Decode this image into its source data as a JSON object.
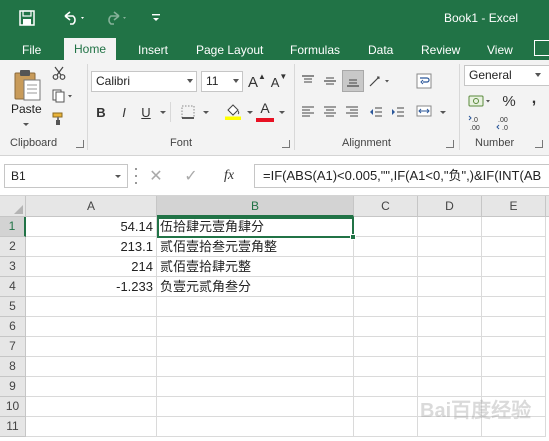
{
  "window": {
    "title": "Book1 - Excel",
    "accent": "#217346"
  },
  "qat": {
    "save_icon": "save-icon",
    "undo_icon": "undo-icon",
    "redo_icon": "redo-icon"
  },
  "tabs": [
    {
      "label": "File"
    },
    {
      "label": "Home"
    },
    {
      "label": "Insert"
    },
    {
      "label": "Page Layout"
    },
    {
      "label": "Formulas"
    },
    {
      "label": "Data"
    },
    {
      "label": "Review"
    },
    {
      "label": "View"
    }
  ],
  "ribbon": {
    "clipboard": {
      "paste_label": "Paste",
      "group_label": "Clipboard"
    },
    "font": {
      "font_name": "Calibri",
      "font_size": "11",
      "grow": "A",
      "shrink": "A",
      "bold": "B",
      "italic": "I",
      "underline": "U",
      "font_color_letter": "A",
      "group_label": "Font"
    },
    "alignment": {
      "group_label": "Alignment"
    },
    "number": {
      "format": "General",
      "percent": "%",
      "comma": ",",
      "group_label": "Number"
    }
  },
  "formula_bar": {
    "name_box": "B1",
    "fx": "fx",
    "formula": "=IF(ABS(A1)<0.005,\"\",IF(A1<0,\"负\",)&IF(INT(AB"
  },
  "grid": {
    "columns": [
      "A",
      "B",
      "C",
      "D",
      "E"
    ],
    "rows": [
      "1",
      "2",
      "3",
      "4",
      "5",
      "6",
      "7",
      "8",
      "9",
      "10",
      "11"
    ],
    "cells": [
      {
        "a": "54.14",
        "b": "伍拾肆元壹角肆分"
      },
      {
        "a": "213.1",
        "b": "贰佰壹拾叁元壹角整"
      },
      {
        "a": "214",
        "b": "贰佰壹拾肆元整"
      },
      {
        "a": "-1.233",
        "b": "负壹元贰角叁分"
      }
    ],
    "selected_cell": "B1"
  },
  "watermark": "Bai百度经验"
}
